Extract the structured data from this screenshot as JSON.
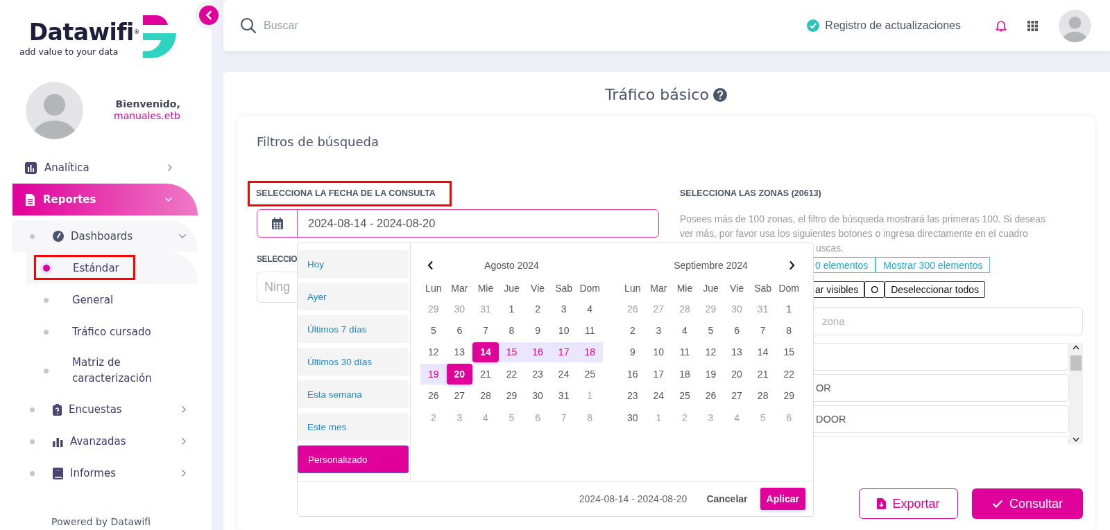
{
  "sidebar": {
    "logo": {
      "name": "Datawifi",
      "mark": "®",
      "tagline": "add value to your data"
    },
    "profile": {
      "greeting": "Bienvenido,",
      "user": "manuales.etb"
    },
    "nav": [
      {
        "label": "Analítica",
        "selected": false,
        "expanded": false
      },
      {
        "label": "Reportes",
        "selected": true,
        "expanded": true,
        "children": [
          {
            "label": "Dashboards",
            "selected": false,
            "expanded": true,
            "children": [
              {
                "label": "Estándar",
                "selected": true,
                "highlighted": true
              },
              {
                "label": "General",
                "selected": false,
                "highlighted": false
              },
              {
                "label": "Tráfico cursado",
                "selected": false,
                "highlighted": false
              },
              {
                "label": "Matriz de caracterización",
                "selected": false,
                "highlighted": false
              }
            ]
          },
          {
            "label": "Encuestas",
            "selected": false,
            "expanded": false
          },
          {
            "label": "Avanzadas",
            "selected": false,
            "expanded": false
          },
          {
            "label": "Informes",
            "selected": false,
            "expanded": false
          }
        ]
      }
    ],
    "footer": "Powered by Datawifi"
  },
  "header": {
    "search": {
      "placeholder": "Buscar"
    },
    "updates": "Registro de actualizaciones"
  },
  "page": {
    "title": "Tráfico básico",
    "filters": {
      "title": "Filtros de búsqueda",
      "date": {
        "label": "SELECCIONA LA FECHA DE LA CONSULTA",
        "highlighted": true,
        "value": "2024-08-14 - 2024-08-20"
      },
      "second": {
        "label": "SELECCIO",
        "placeholder": "Ning"
      },
      "zones": {
        "label": "SELECCIONA LAS ZONAS (20613)",
        "note_lines": [
          "Posees más de 100 zonas, el filtro de búsqueda mostrará las primeras 100. Si deseas",
          "ver más, por favor usa los siguientes botones o ingresa directamente en el cuadro"
        ],
        "note_tail": "uscas.",
        "show_buttons": [
          "0 elementos",
          "Mostrar 300 elementos"
        ],
        "select_buttons": [
          "ar visibles",
          "O",
          "Deseleccionar todos"
        ],
        "search": {
          "placeholder": "zona"
        },
        "items": [
          {
            "kind": "blank"
          },
          {
            "kind": "text",
            "label": "OR"
          },
          {
            "kind": "text",
            "label": "DOOR"
          },
          {
            "kind": "blank"
          }
        ]
      },
      "actions": [
        {
          "label": "Exportar",
          "kind": "outline"
        },
        {
          "label": "Consultar",
          "kind": "primary"
        }
      ]
    }
  },
  "picker": {
    "ranges": [
      {
        "label": "Hoy",
        "selected": false
      },
      {
        "label": "Ayer",
        "selected": false
      },
      {
        "label": "Últimos 7 días",
        "selected": false
      },
      {
        "label": "Últimos 30 días",
        "selected": false
      },
      {
        "label": "Esta semana",
        "selected": false
      },
      {
        "label": "Este mes",
        "selected": false
      },
      {
        "label": "Personalizado",
        "selected": true
      }
    ],
    "months": [
      {
        "title": "Agosto 2024",
        "weekdays": [
          "Lun",
          "Mar",
          "Mie",
          "Jue",
          "Vie",
          "Sab",
          "Dom"
        ],
        "days": [
          {
            "label": "29",
            "outside": true,
            "in_range": false,
            "selected": false
          },
          {
            "label": "30",
            "outside": true,
            "in_range": false,
            "selected": false
          },
          {
            "label": "31",
            "outside": true,
            "in_range": false,
            "selected": false
          },
          {
            "label": "1",
            "outside": false,
            "in_range": false,
            "selected": false
          },
          {
            "label": "2",
            "outside": false,
            "in_range": false,
            "selected": false
          },
          {
            "label": "3",
            "outside": false,
            "in_range": false,
            "selected": false
          },
          {
            "label": "4",
            "outside": false,
            "in_range": false,
            "selected": false
          },
          {
            "label": "5",
            "outside": false,
            "in_range": false,
            "selected": false
          },
          {
            "label": "6",
            "outside": false,
            "in_range": false,
            "selected": false
          },
          {
            "label": "7",
            "outside": false,
            "in_range": false,
            "selected": false
          },
          {
            "label": "8",
            "outside": false,
            "in_range": false,
            "selected": false
          },
          {
            "label": "9",
            "outside": false,
            "in_range": false,
            "selected": false
          },
          {
            "label": "10",
            "outside": false,
            "in_range": false,
            "selected": false
          },
          {
            "label": "11",
            "outside": false,
            "in_range": false,
            "selected": false
          },
          {
            "label": "12",
            "outside": false,
            "in_range": false,
            "selected": false
          },
          {
            "label": "13",
            "outside": false,
            "in_range": false,
            "selected": false
          },
          {
            "label": "14",
            "outside": false,
            "in_range": true,
            "selected": true
          },
          {
            "label": "15",
            "outside": false,
            "in_range": true,
            "selected": false
          },
          {
            "label": "16",
            "outside": false,
            "in_range": true,
            "selected": false
          },
          {
            "label": "17",
            "outside": false,
            "in_range": true,
            "selected": false
          },
          {
            "label": "18",
            "outside": false,
            "in_range": true,
            "selected": false
          },
          {
            "label": "19",
            "outside": false,
            "in_range": true,
            "selected": false
          },
          {
            "label": "20",
            "outside": false,
            "in_range": true,
            "selected": true
          },
          {
            "label": "21",
            "outside": false,
            "in_range": false,
            "selected": false
          },
          {
            "label": "22",
            "outside": false,
            "in_range": false,
            "selected": false
          },
          {
            "label": "23",
            "outside": false,
            "in_range": false,
            "selected": false
          },
          {
            "label": "24",
            "outside": false,
            "in_range": false,
            "selected": false
          },
          {
            "label": "25",
            "outside": false,
            "in_range": false,
            "selected": false
          },
          {
            "label": "26",
            "outside": false,
            "in_range": false,
            "selected": false
          },
          {
            "label": "27",
            "outside": false,
            "in_range": false,
            "selected": false
          },
          {
            "label": "28",
            "outside": false,
            "in_range": false,
            "selected": false
          },
          {
            "label": "29",
            "outside": false,
            "in_range": false,
            "selected": false
          },
          {
            "label": "30",
            "outside": false,
            "in_range": false,
            "selected": false
          },
          {
            "label": "31",
            "outside": false,
            "in_range": false,
            "selected": false
          },
          {
            "label": "1",
            "outside": true,
            "in_range": false,
            "selected": false
          },
          {
            "label": "2",
            "outside": true,
            "in_range": false,
            "selected": false
          },
          {
            "label": "3",
            "outside": true,
            "in_range": false,
            "selected": false
          },
          {
            "label": "4",
            "outside": true,
            "in_range": false,
            "selected": false
          },
          {
            "label": "5",
            "outside": true,
            "in_range": false,
            "selected": false
          },
          {
            "label": "6",
            "outside": true,
            "in_range": false,
            "selected": false
          },
          {
            "label": "7",
            "outside": true,
            "in_range": false,
            "selected": false
          },
          {
            "label": "8",
            "outside": true,
            "in_range": false,
            "selected": false
          }
        ]
      },
      {
        "title": "Septiembre 2024",
        "weekdays": [
          "Lun",
          "Mar",
          "Mie",
          "Jue",
          "Vie",
          "Sab",
          "Dom"
        ],
        "days": [
          {
            "label": "26",
            "outside": true,
            "in_range": false,
            "selected": false
          },
          {
            "label": "27",
            "outside": true,
            "in_range": false,
            "selected": false
          },
          {
            "label": "28",
            "outside": true,
            "in_range": false,
            "selected": false
          },
          {
            "label": "29",
            "outside": true,
            "in_range": false,
            "selected": false
          },
          {
            "label": "30",
            "outside": true,
            "in_range": false,
            "selected": false
          },
          {
            "label": "31",
            "outside": true,
            "in_range": false,
            "selected": false
          },
          {
            "label": "1",
            "outside": false,
            "in_range": false,
            "selected": false
          },
          {
            "label": "2",
            "outside": false,
            "in_range": false,
            "selected": false
          },
          {
            "label": "3",
            "outside": false,
            "in_range": false,
            "selected": false
          },
          {
            "label": "4",
            "outside": false,
            "in_range": false,
            "selected": false
          },
          {
            "label": "5",
            "outside": false,
            "in_range": false,
            "selected": false
          },
          {
            "label": "6",
            "outside": false,
            "in_range": false,
            "selected": false
          },
          {
            "label": "7",
            "outside": false,
            "in_range": false,
            "selected": false
          },
          {
            "label": "8",
            "outside": false,
            "in_range": false,
            "selected": false
          },
          {
            "label": "9",
            "outside": false,
            "in_range": false,
            "selected": false
          },
          {
            "label": "10",
            "outside": false,
            "in_range": false,
            "selected": false
          },
          {
            "label": "11",
            "outside": false,
            "in_range": false,
            "selected": false
          },
          {
            "label": "12",
            "outside": false,
            "in_range": false,
            "selected": false
          },
          {
            "label": "13",
            "outside": false,
            "in_range": false,
            "selected": false
          },
          {
            "label": "14",
            "outside": false,
            "in_range": false,
            "selected": false
          },
          {
            "label": "15",
            "outside": false,
            "in_range": false,
            "selected": false
          },
          {
            "label": "16",
            "outside": false,
            "in_range": false,
            "selected": false
          },
          {
            "label": "17",
            "outside": false,
            "in_range": false,
            "selected": false
          },
          {
            "label": "18",
            "outside": false,
            "in_range": false,
            "selected": false
          },
          {
            "label": "19",
            "outside": false,
            "in_range": false,
            "selected": false
          },
          {
            "label": "20",
            "outside": false,
            "in_range": false,
            "selected": false
          },
          {
            "label": "21",
            "outside": false,
            "in_range": false,
            "selected": false
          },
          {
            "label": "22",
            "outside": false,
            "in_range": false,
            "selected": false
          },
          {
            "label": "23",
            "outside": false,
            "in_range": false,
            "selected": false
          },
          {
            "label": "24",
            "outside": false,
            "in_range": false,
            "selected": false
          },
          {
            "label": "25",
            "outside": false,
            "in_range": false,
            "selected": false
          },
          {
            "label": "26",
            "outside": false,
            "in_range": false,
            "selected": false
          },
          {
            "label": "27",
            "outside": false,
            "in_range": false,
            "selected": false
          },
          {
            "label": "28",
            "outside": false,
            "in_range": false,
            "selected": false
          },
          {
            "label": "29",
            "outside": false,
            "in_range": false,
            "selected": false
          },
          {
            "label": "30",
            "outside": false,
            "in_range": false,
            "selected": false
          },
          {
            "label": "1",
            "outside": true,
            "in_range": false,
            "selected": false
          },
          {
            "label": "2",
            "outside": true,
            "in_range": false,
            "selected": false
          },
          {
            "label": "3",
            "outside": true,
            "in_range": false,
            "selected": false
          },
          {
            "label": "4",
            "outside": true,
            "in_range": false,
            "selected": false
          },
          {
            "label": "5",
            "outside": true,
            "in_range": false,
            "selected": false
          },
          {
            "label": "6",
            "outside": true,
            "in_range": false,
            "selected": false
          }
        ]
      }
    ],
    "footer": {
      "range": "2024-08-14 - 2024-08-20",
      "cancel": "Cancelar",
      "apply": "Aplicar"
    }
  }
}
